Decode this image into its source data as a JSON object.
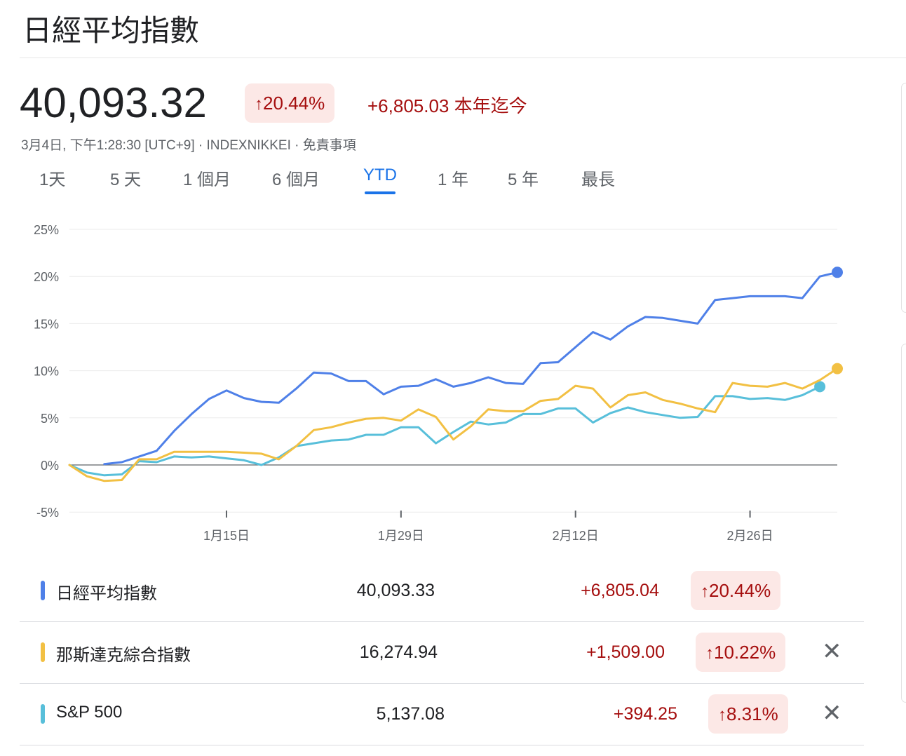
{
  "title": "日經平均指數",
  "quote": {
    "price": "40,093.32",
    "pct_arrow": "↑",
    "pct_change": "20.44%",
    "abs_change": "+6,805.03",
    "period_label": "本年迄今",
    "meta": "3月4日, 下午1:28:30 [UTC+9] · INDEXNIKKEI · 免責事項"
  },
  "tabs": [
    {
      "label": "1天"
    },
    {
      "label": "5 天"
    },
    {
      "label": "1 個月"
    },
    {
      "label": "6 個月"
    },
    {
      "label": "YTD",
      "active": true
    },
    {
      "label": "1 年"
    },
    {
      "label": "5 年"
    },
    {
      "label": "最長"
    }
  ],
  "colors": {
    "nikkei": "#4f80e8",
    "nasdaq": "#f2c043",
    "sp500": "#58bfda",
    "negative_bg": "#fce8e6",
    "positive_text": "#a50e0e",
    "active_tab": "#1a73e8"
  },
  "chart_data": {
    "type": "line",
    "y_ticks": [
      "25%",
      "20%",
      "15%",
      "10%",
      "5%",
      "0%",
      "-5%"
    ],
    "ylim": [
      -5,
      25
    ],
    "x_ticks": [
      {
        "label": "1月15日",
        "index": 9
      },
      {
        "label": "1月29日",
        "index": 19
      },
      {
        "label": "2月12日",
        "index": 29
      },
      {
        "label": "2月26日",
        "index": 39
      }
    ],
    "x_count": 45,
    "grid": true,
    "series": [
      {
        "name": "日經平均指數",
        "color": "#4f80e8",
        "start_index": 2,
        "values": [
          0.1,
          0.3,
          0.9,
          1.5,
          3.6,
          5.4,
          7.0,
          7.9,
          7.1,
          6.7,
          6.6,
          8.1,
          9.8,
          9.7,
          8.9,
          8.9,
          7.5,
          8.3,
          8.4,
          9.1,
          8.3,
          8.7,
          9.3,
          8.7,
          8.6,
          10.8,
          10.9,
          12.5,
          14.1,
          13.3,
          14.7,
          15.7,
          15.6,
          15.3,
          15.0,
          17.5,
          17.7,
          17.9,
          17.9,
          17.9,
          17.7,
          20.0,
          20.44
        ]
      },
      {
        "name": "那斯達克綜合指數",
        "color": "#f2c043",
        "start_index": 0,
        "values": [
          0.0,
          -1.2,
          -1.7,
          -1.6,
          0.6,
          0.6,
          1.4,
          1.4,
          1.4,
          1.4,
          1.3,
          1.2,
          0.6,
          2.0,
          3.7,
          4.0,
          4.5,
          4.9,
          5.0,
          4.7,
          5.9,
          5.1,
          2.7,
          4.1,
          5.9,
          5.7,
          5.7,
          6.8,
          7.0,
          8.4,
          8.1,
          6.1,
          7.4,
          7.7,
          6.9,
          6.5,
          6.0,
          5.6,
          8.7,
          8.4,
          8.3,
          8.7,
          8.1,
          9.0,
          10.22
        ]
      },
      {
        "name": "S&P 500",
        "color": "#58bfda",
        "start_index": 0,
        "values": [
          0.0,
          -0.8,
          -1.1,
          -1.0,
          0.4,
          0.3,
          0.9,
          0.8,
          0.9,
          0.7,
          0.5,
          0.0,
          0.8,
          2.0,
          2.3,
          2.6,
          2.7,
          3.2,
          3.2,
          4.0,
          4.0,
          2.3,
          3.5,
          4.6,
          4.3,
          4.5,
          5.4,
          5.4,
          6.0,
          6.0,
          4.5,
          5.5,
          6.1,
          5.6,
          5.3,
          5.0,
          5.1,
          7.3,
          7.3,
          7.0,
          7.1,
          6.9,
          7.4,
          8.31
        ]
      }
    ]
  },
  "comparison": [
    {
      "name": "日經平均指數",
      "value": "40,093.33",
      "change": "+6,805.04",
      "arrow": "↑",
      "pct": "20.44%",
      "color": "#4f80e8",
      "removable": false
    },
    {
      "name": "那斯達克綜合指數",
      "value": "16,274.94",
      "change": "+1,509.00",
      "arrow": "↑",
      "pct": "10.22%",
      "color": "#f2c043",
      "removable": true
    },
    {
      "name": "S&P 500",
      "value": "5,137.08",
      "change": "+394.25",
      "arrow": "↑",
      "pct": "8.31%",
      "color": "#58bfda",
      "removable": true
    }
  ],
  "remove_icon": "close-icon",
  "remove_glyph": "✕"
}
